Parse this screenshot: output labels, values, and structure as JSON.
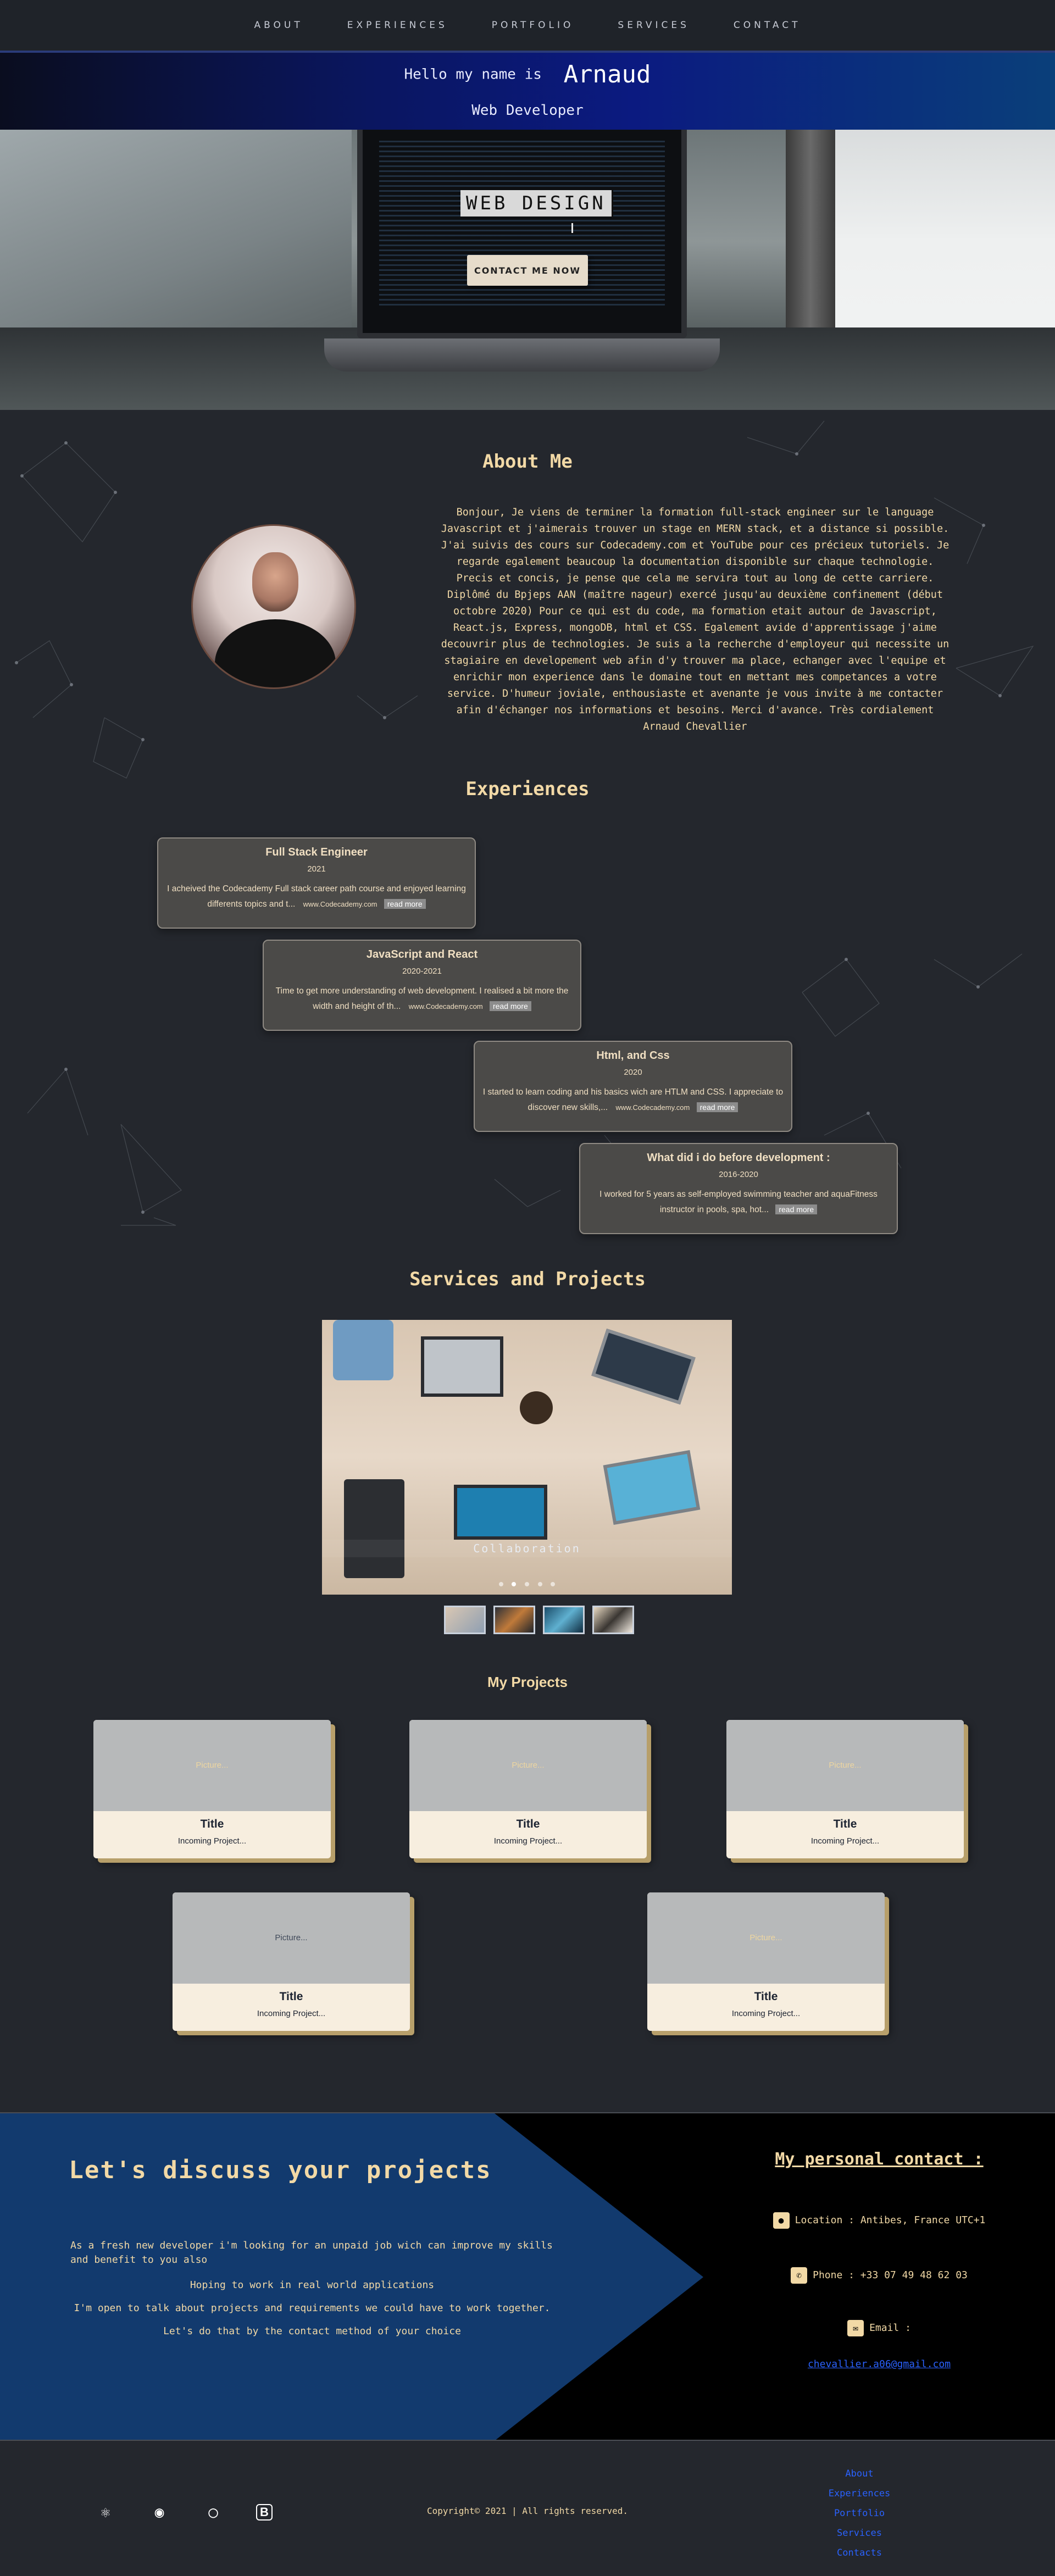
{
  "nav": {
    "items": [
      "ABOUT",
      "EXPERIENCES",
      "PORTFOLIO",
      "SERVICES",
      "CONTACT"
    ]
  },
  "intro": {
    "hello": "Hello my name is",
    "name": "Arnaud",
    "role": "Web Developer"
  },
  "hero": {
    "typed_text": "WEB DESIGN",
    "cta": "CONTACT ME NOW"
  },
  "about": {
    "title": "About Me",
    "text": "Bonjour, Je viens de terminer la formation full-stack engineer sur le language Javascript et j'aimerais trouver un stage en MERN stack, et a distance si possible. J'ai suivis des cours sur Codecademy.com et YouTube pour ces précieux tutoriels. Je regarde egalement beaucoup la documentation disponible sur chaque technologie. Precis et concis, je pense que cela me servira tout au long de cette carriere. Diplômé du Bpjeps AAN (maître nageur) exercé jusqu'au deuxième confinement (début octobre 2020) Pour ce qui est du code, ma formation etait autour de Javascript, React.js, Express, mongoDB, html et CSS. Egalement avide d'apprentissage j'aime decouvrir plus de technologies. Je suis a la recherche d'employeur qui necessite un stagiaire en developement web afin d'y trouver ma place, echanger avec l'equipe et enrichir mon experience dans le domaine tout en mettant mes competances a votre service. D'humeur joviale, enthousiaste et avenante je vous invite à me contacter afin d'échanger nos informations et besoins. Merci d'avance. Très cordialement Arnaud Chevallier"
  },
  "experiences": {
    "title": "Experiences",
    "items": [
      {
        "title": "Full Stack Engineer",
        "year": "2021",
        "desc": "I acheived the Codecademy Full stack career path course and enjoyed learning differents topics and t...",
        "link": "www.Codecademy.com",
        "more": "read more"
      },
      {
        "title": "JavaScript and React",
        "year": "2020-2021",
        "desc": "Time to get more understanding of web development. I realised a bit more the width and height of th...",
        "link": "www.Codecademy.com",
        "more": "read more"
      },
      {
        "title": "Html, and Css",
        "year": "2020",
        "desc": "I started to learn coding and his basics wich are HTLM and CSS. I appreciate to discover new skills,...",
        "link": "www.Codecademy.com",
        "more": "read more"
      },
      {
        "title": "What did i do before development :",
        "year": "2016-2020",
        "desc": "I worked for 5 years as self-employed swimming teacher and aquaFitness instructor in pools, spa, hot...",
        "link": "",
        "more": "read more"
      }
    ]
  },
  "services": {
    "title": "Services and Projects",
    "caption": "Collaboration",
    "slide_count": 5,
    "active_slide": 1,
    "thumbnail_count": 4
  },
  "projects": {
    "title": "My Projects",
    "items": [
      {
        "picture": "Picture...",
        "title": "Title",
        "subtitle": "Incoming Project..."
      },
      {
        "picture": "Picture...",
        "title": "Title",
        "subtitle": "Incoming Project..."
      },
      {
        "picture": "Picture...",
        "title": "Title",
        "subtitle": "Incoming Project..."
      },
      {
        "picture": "Picture...",
        "title": "Title",
        "subtitle": "Incoming Project..."
      },
      {
        "picture": "Picture...",
        "title": "Title",
        "subtitle": "Incoming Project..."
      }
    ]
  },
  "contact": {
    "title": "Let's discuss your projects",
    "para1": "As a fresh new developer i'm looking for an unpaid job wich can improve my skills and benefit to you also",
    "para2": "Hoping to work in real world applications",
    "para3": "I'm open to talk about projects and requirements we could have to work together.",
    "para4": "Let's do that by the contact method of your choice",
    "personal_title": "My personal contact :",
    "location": "Location : Antibes, France UTC+1",
    "phone": "Phone : +33 07 49 48 62 03",
    "email_label": "Email :",
    "email": "chevallier.a06@gmail.com"
  },
  "footer": {
    "icons": [
      "react-icon",
      "codecademy-icon",
      "github-icon",
      "bootstrap-icon"
    ],
    "copyright": "Copyright© 2021 | All rights reserved.",
    "links": [
      "About",
      "Experiences",
      "Portfolio",
      "Services",
      "Contacts"
    ]
  },
  "colors": {
    "background": "#24272d",
    "accent": "#f2d9a6",
    "link": "#2a62ff",
    "contact_panel": "#123a6e"
  }
}
